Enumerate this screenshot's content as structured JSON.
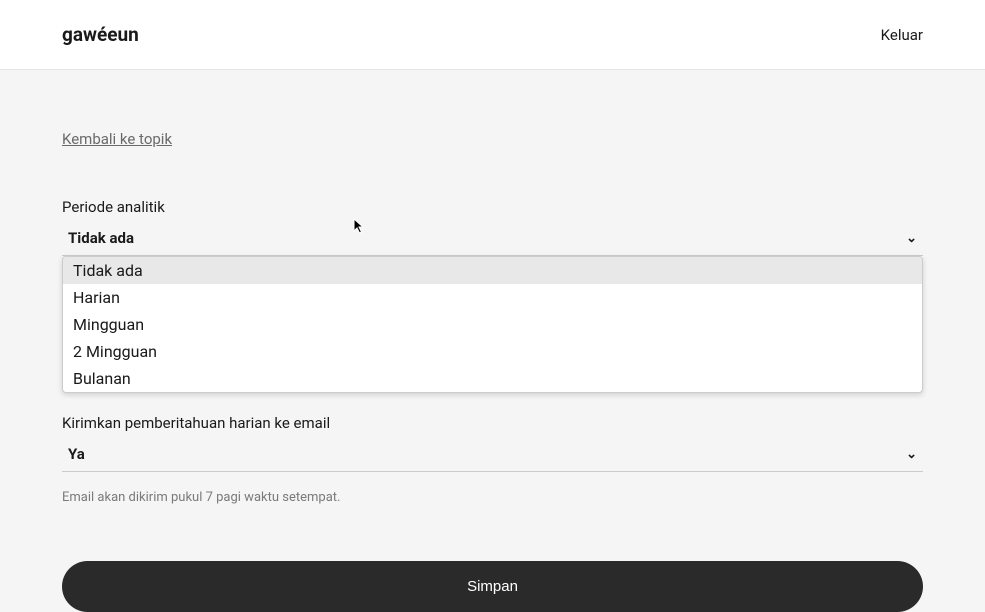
{
  "header": {
    "logo": "gawéeun",
    "logout": "Keluar"
  },
  "nav": {
    "back_link": "Kembali ke topik"
  },
  "form": {
    "analytics_period": {
      "label": "Periode analitik",
      "selected": "Tidak ada",
      "options": [
        "Tidak ada",
        "Harian",
        "Mingguan",
        "2 Mingguan",
        "Bulanan"
      ]
    },
    "daily_notification": {
      "label": "Kirimkan pemberitahuan harian ke email",
      "selected": "Ya",
      "helper": "Email akan dikirim pukul 7 pagi waktu setempat."
    },
    "save_button": "Simpan"
  }
}
